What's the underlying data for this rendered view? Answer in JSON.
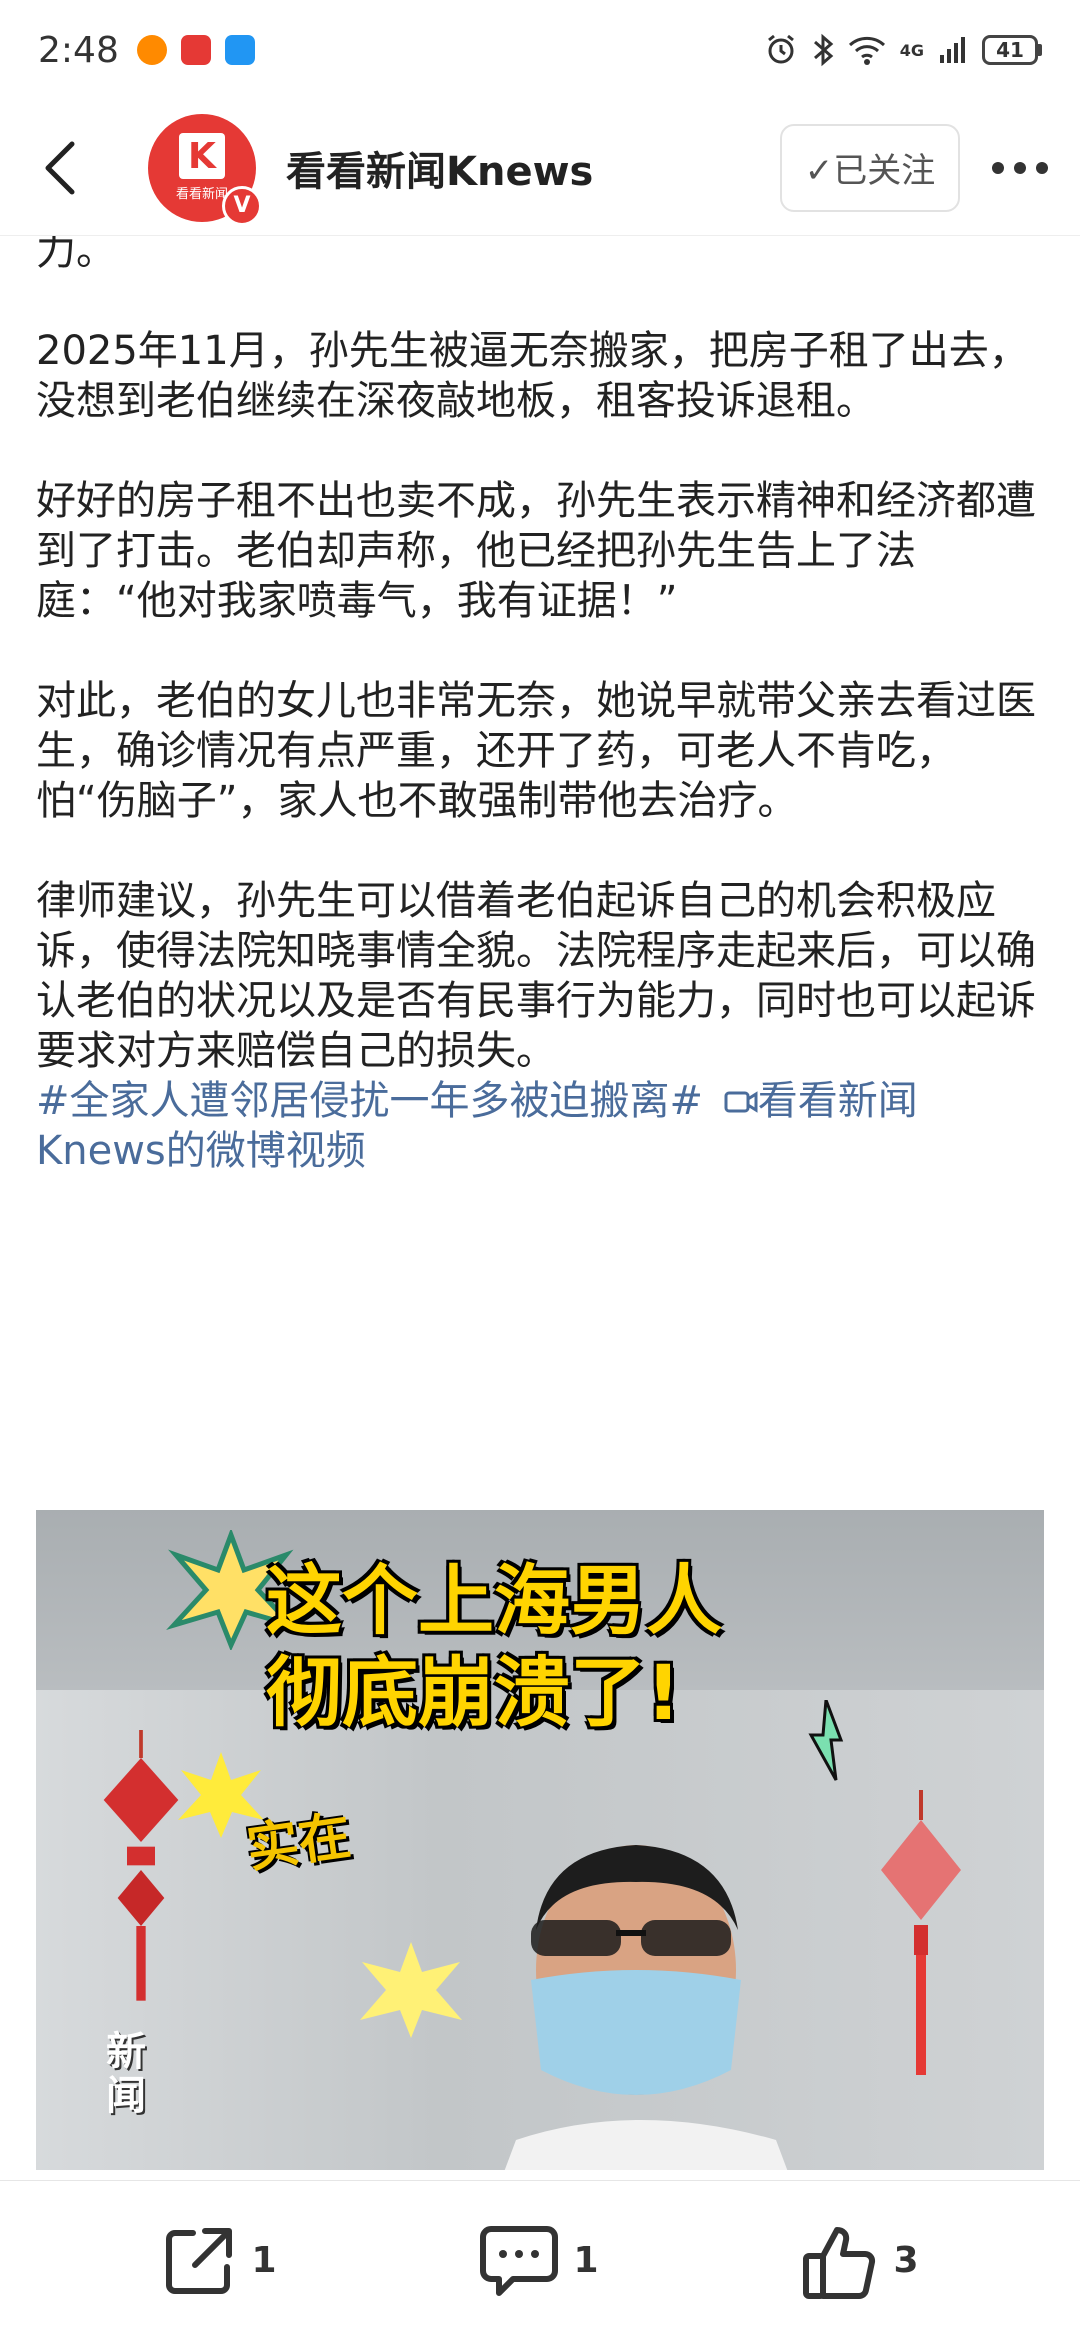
{
  "status_bar": {
    "time": "2:48",
    "network": "4G",
    "battery": "41"
  },
  "header": {
    "account_name": "看看新闻Knews",
    "avatar_text": "看看新闻",
    "verified_mark": "V",
    "follow_label": "✓已关注"
  },
  "article": {
    "paragraphs": [
      "力。",
      "2025年11月，孙先生被逼无奈搬家，把房子租了出去，没想到老伯继续在深夜敲地板，租客投诉退租。",
      "好好的房子租不出也卖不成，孙先生表示精神和经济都遭到了打击。老伯却声称，他已经把孙先生告上了法庭：“他对我家喷毒气，我有证据！”",
      "对此，老伯的女儿也非常无奈，她说早就带父亲去看过医生，确诊情况有点严重，还开了药，可老人不肯吃，怕“伤脑子”，家人也不敢强制带他去治疗。",
      "律师建议，孙先生可以借着老伯起诉自己的机会积极应诉，使得法院知晓事情全貌。法院程序走起来后，可以确认老伯的状况以及是否有民事行为能力，同时也可以起诉要求对方来赔偿自己的损失。"
    ],
    "hashtag": "#全家人遭邻居侵扰一年多被迫搬离#",
    "video_link": "看看新闻Knews的微博视频"
  },
  "video": {
    "headline_line1": "这个上海男人",
    "headline_line2": "彻底崩溃了!",
    "caption": "实在",
    "watermark": "新闻"
  },
  "actions": {
    "repost_count": "1",
    "comment_count": "1",
    "like_count": "3"
  },
  "colors": {
    "brand_red": "#e53935",
    "link_blue": "#4a6c9b",
    "headline_yellow": "#ffd400"
  }
}
